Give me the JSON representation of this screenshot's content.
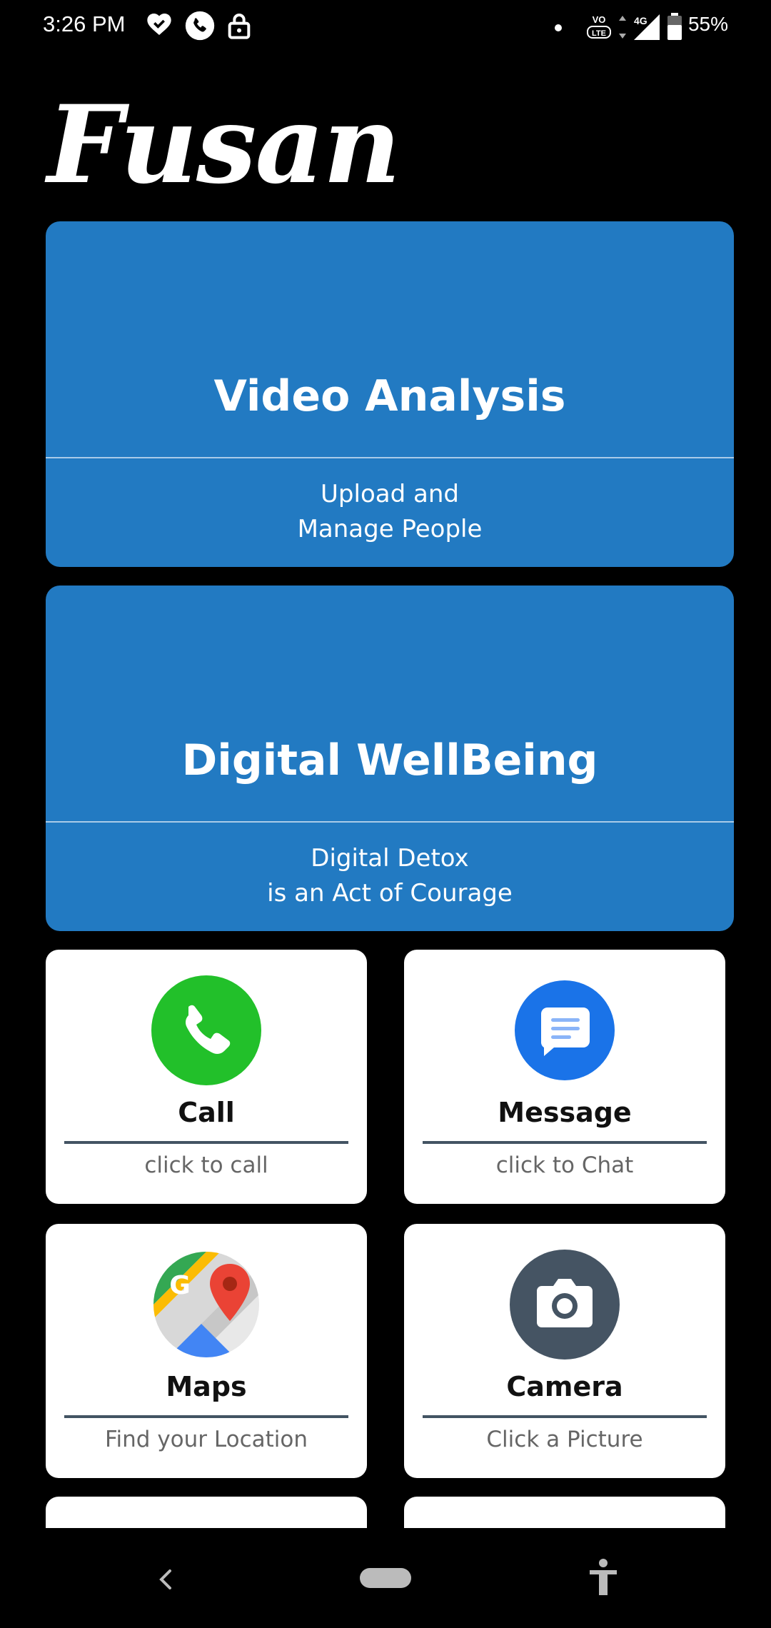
{
  "status_bar": {
    "time": "3:26 PM",
    "battery": "55%",
    "left_icons": [
      "heart-check-icon",
      "phone-call-icon",
      "lock-icon"
    ],
    "right_icons": [
      "dot-icon",
      "volte-icon",
      "4g-icon",
      "signal-icon",
      "battery-icon"
    ]
  },
  "app": {
    "logo_text": "Fusan"
  },
  "features": [
    {
      "title": "Video Analysis",
      "subtitle_line1": "Upload and",
      "subtitle_line2": "Manage People"
    },
    {
      "title": "Digital WellBeing",
      "subtitle_line1": "Digital Detox",
      "subtitle_line2": "is an Act of Courage"
    }
  ],
  "tiles": [
    {
      "label": "Call",
      "sub": "click to call",
      "icon": "phone-icon",
      "color": "#22c02a"
    },
    {
      "label": "Message",
      "sub": "click to Chat",
      "icon": "message-icon",
      "color": "#1a73e8"
    },
    {
      "label": "Maps",
      "sub": "Find your Location",
      "icon": "maps-icon",
      "color": "#34a853"
    },
    {
      "label": "Camera",
      "sub": "Click a Picture",
      "icon": "camera-icon",
      "color": "#455463"
    }
  ],
  "nav": {
    "icons": [
      "back-icon",
      "home-pill-icon",
      "accessibility-icon"
    ]
  }
}
